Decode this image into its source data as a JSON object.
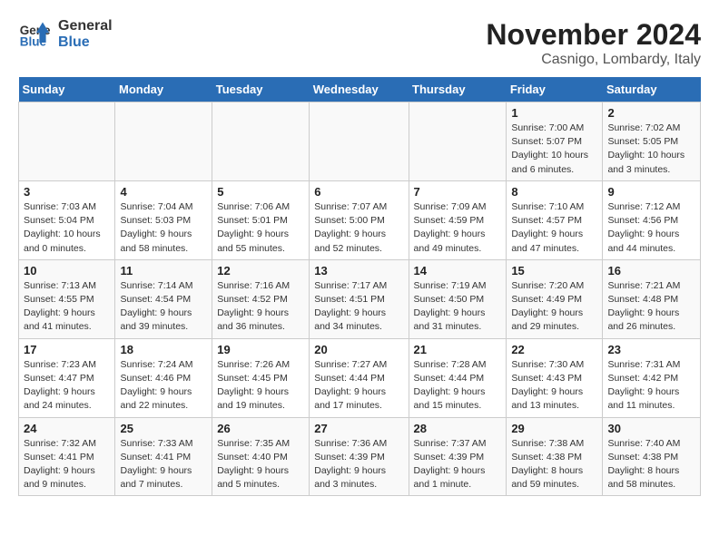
{
  "header": {
    "logo_line1": "General",
    "logo_line2": "Blue",
    "month_title": "November 2024",
    "location": "Casnigo, Lombardy, Italy"
  },
  "weekdays": [
    "Sunday",
    "Monday",
    "Tuesday",
    "Wednesday",
    "Thursday",
    "Friday",
    "Saturday"
  ],
  "weeks": [
    [
      {
        "day": "",
        "info": ""
      },
      {
        "day": "",
        "info": ""
      },
      {
        "day": "",
        "info": ""
      },
      {
        "day": "",
        "info": ""
      },
      {
        "day": "",
        "info": ""
      },
      {
        "day": "1",
        "info": "Sunrise: 7:00 AM\nSunset: 5:07 PM\nDaylight: 10 hours\nand 6 minutes."
      },
      {
        "day": "2",
        "info": "Sunrise: 7:02 AM\nSunset: 5:05 PM\nDaylight: 10 hours\nand 3 minutes."
      }
    ],
    [
      {
        "day": "3",
        "info": "Sunrise: 7:03 AM\nSunset: 5:04 PM\nDaylight: 10 hours\nand 0 minutes."
      },
      {
        "day": "4",
        "info": "Sunrise: 7:04 AM\nSunset: 5:03 PM\nDaylight: 9 hours\nand 58 minutes."
      },
      {
        "day": "5",
        "info": "Sunrise: 7:06 AM\nSunset: 5:01 PM\nDaylight: 9 hours\nand 55 minutes."
      },
      {
        "day": "6",
        "info": "Sunrise: 7:07 AM\nSunset: 5:00 PM\nDaylight: 9 hours\nand 52 minutes."
      },
      {
        "day": "7",
        "info": "Sunrise: 7:09 AM\nSunset: 4:59 PM\nDaylight: 9 hours\nand 49 minutes."
      },
      {
        "day": "8",
        "info": "Sunrise: 7:10 AM\nSunset: 4:57 PM\nDaylight: 9 hours\nand 47 minutes."
      },
      {
        "day": "9",
        "info": "Sunrise: 7:12 AM\nSunset: 4:56 PM\nDaylight: 9 hours\nand 44 minutes."
      }
    ],
    [
      {
        "day": "10",
        "info": "Sunrise: 7:13 AM\nSunset: 4:55 PM\nDaylight: 9 hours\nand 41 minutes."
      },
      {
        "day": "11",
        "info": "Sunrise: 7:14 AM\nSunset: 4:54 PM\nDaylight: 9 hours\nand 39 minutes."
      },
      {
        "day": "12",
        "info": "Sunrise: 7:16 AM\nSunset: 4:52 PM\nDaylight: 9 hours\nand 36 minutes."
      },
      {
        "day": "13",
        "info": "Sunrise: 7:17 AM\nSunset: 4:51 PM\nDaylight: 9 hours\nand 34 minutes."
      },
      {
        "day": "14",
        "info": "Sunrise: 7:19 AM\nSunset: 4:50 PM\nDaylight: 9 hours\nand 31 minutes."
      },
      {
        "day": "15",
        "info": "Sunrise: 7:20 AM\nSunset: 4:49 PM\nDaylight: 9 hours\nand 29 minutes."
      },
      {
        "day": "16",
        "info": "Sunrise: 7:21 AM\nSunset: 4:48 PM\nDaylight: 9 hours\nand 26 minutes."
      }
    ],
    [
      {
        "day": "17",
        "info": "Sunrise: 7:23 AM\nSunset: 4:47 PM\nDaylight: 9 hours\nand 24 minutes."
      },
      {
        "day": "18",
        "info": "Sunrise: 7:24 AM\nSunset: 4:46 PM\nDaylight: 9 hours\nand 22 minutes."
      },
      {
        "day": "19",
        "info": "Sunrise: 7:26 AM\nSunset: 4:45 PM\nDaylight: 9 hours\nand 19 minutes."
      },
      {
        "day": "20",
        "info": "Sunrise: 7:27 AM\nSunset: 4:44 PM\nDaylight: 9 hours\nand 17 minutes."
      },
      {
        "day": "21",
        "info": "Sunrise: 7:28 AM\nSunset: 4:44 PM\nDaylight: 9 hours\nand 15 minutes."
      },
      {
        "day": "22",
        "info": "Sunrise: 7:30 AM\nSunset: 4:43 PM\nDaylight: 9 hours\nand 13 minutes."
      },
      {
        "day": "23",
        "info": "Sunrise: 7:31 AM\nSunset: 4:42 PM\nDaylight: 9 hours\nand 11 minutes."
      }
    ],
    [
      {
        "day": "24",
        "info": "Sunrise: 7:32 AM\nSunset: 4:41 PM\nDaylight: 9 hours\nand 9 minutes."
      },
      {
        "day": "25",
        "info": "Sunrise: 7:33 AM\nSunset: 4:41 PM\nDaylight: 9 hours\nand 7 minutes."
      },
      {
        "day": "26",
        "info": "Sunrise: 7:35 AM\nSunset: 4:40 PM\nDaylight: 9 hours\nand 5 minutes."
      },
      {
        "day": "27",
        "info": "Sunrise: 7:36 AM\nSunset: 4:39 PM\nDaylight: 9 hours\nand 3 minutes."
      },
      {
        "day": "28",
        "info": "Sunrise: 7:37 AM\nSunset: 4:39 PM\nDaylight: 9 hours\nand 1 minute."
      },
      {
        "day": "29",
        "info": "Sunrise: 7:38 AM\nSunset: 4:38 PM\nDaylight: 8 hours\nand 59 minutes."
      },
      {
        "day": "30",
        "info": "Sunrise: 7:40 AM\nSunset: 4:38 PM\nDaylight: 8 hours\nand 58 minutes."
      }
    ]
  ]
}
